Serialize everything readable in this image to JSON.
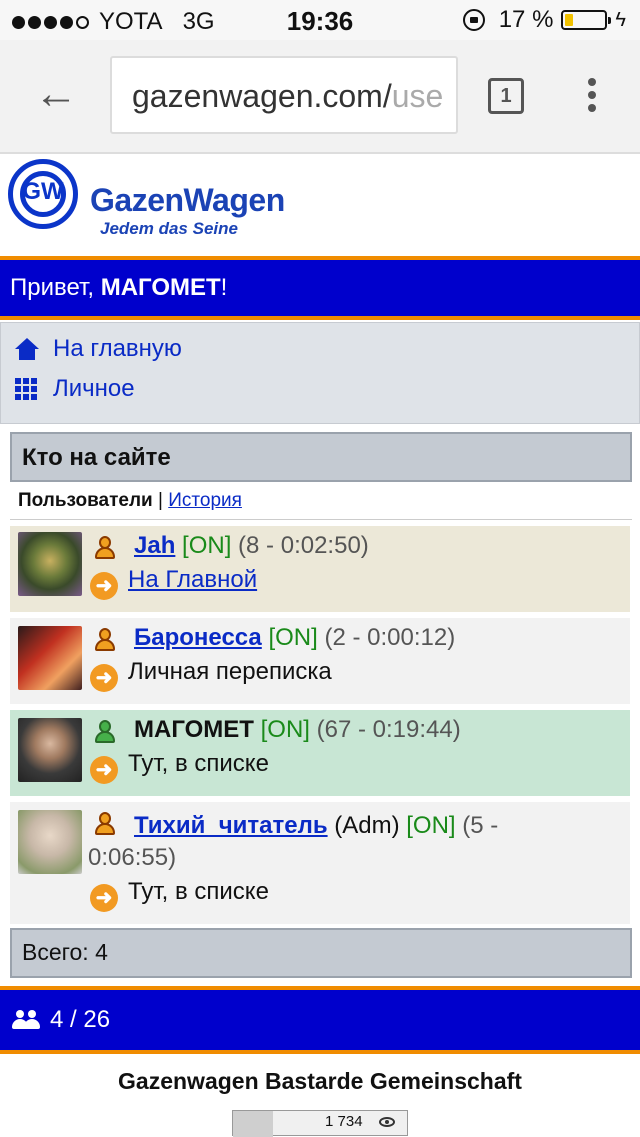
{
  "status_bar": {
    "carrier": "YOTA",
    "network": "3G",
    "time": "19:36",
    "battery_text": "17 %",
    "battery_level_percent": 17
  },
  "browser": {
    "url_main": "gazenwagen.com/",
    "url_faded": "use",
    "tab_count": "1",
    "icons": [
      "back-arrow-icon",
      "tabs-icon",
      "overflow-menu-icon"
    ]
  },
  "site": {
    "logo_letters": "GW",
    "title": "GazenWagen",
    "subtitle": "Jedem das Seine",
    "greeting_prefix": "Привет, ",
    "greeting_name": "МАГОМЕТ",
    "greeting_suffix": "!",
    "nav": [
      {
        "label": "На главную",
        "icon": "home-icon"
      },
      {
        "label": "Личное",
        "icon": "grid-icon"
      }
    ]
  },
  "who_online": {
    "title": "Кто на сайте",
    "tab_active": "Пользователи",
    "tab_sep": " | ",
    "tab_link": "История",
    "users": [
      {
        "name": "Jah",
        "role": "",
        "status": "[ON]",
        "stats": "(8 - 0:02:50)",
        "location": "На Главной",
        "location_is_link": true
      },
      {
        "name": "Баронесса",
        "role": "",
        "status": "[ON]",
        "stats": "(2 - 0:00:12)",
        "location": "Личная переписка",
        "location_is_link": false
      },
      {
        "name": "МАГОМЕТ",
        "role": "",
        "status": "[ON]",
        "stats": "(67 - 0:19:44)",
        "location": "Тут, в списке",
        "location_is_link": false
      },
      {
        "name": "Тихий_читатель",
        "role": " (Adm) ",
        "status": "[ON]",
        "stats_line1": "(5 -",
        "stats_line2": "0:06:55)",
        "location": "Тут, в списке",
        "location_is_link": false
      }
    ],
    "total": "Всего: 4"
  },
  "footer": {
    "online_count": "4 / 26",
    "community": "Gazenwagen Bastarde Gemeinschaft",
    "counter_value": "1 734"
  },
  "colors": {
    "brand_blue": "#0000cc",
    "accent_orange": "#f08c00",
    "link_blue": "#0a2bc6",
    "online_green": "#1a8a1a",
    "row1_bg": "#ece8d8",
    "row2_bg": "#f2f2f2",
    "row3_bg": "#c8e6d4",
    "row4_bg": "#f2f2f2"
  }
}
